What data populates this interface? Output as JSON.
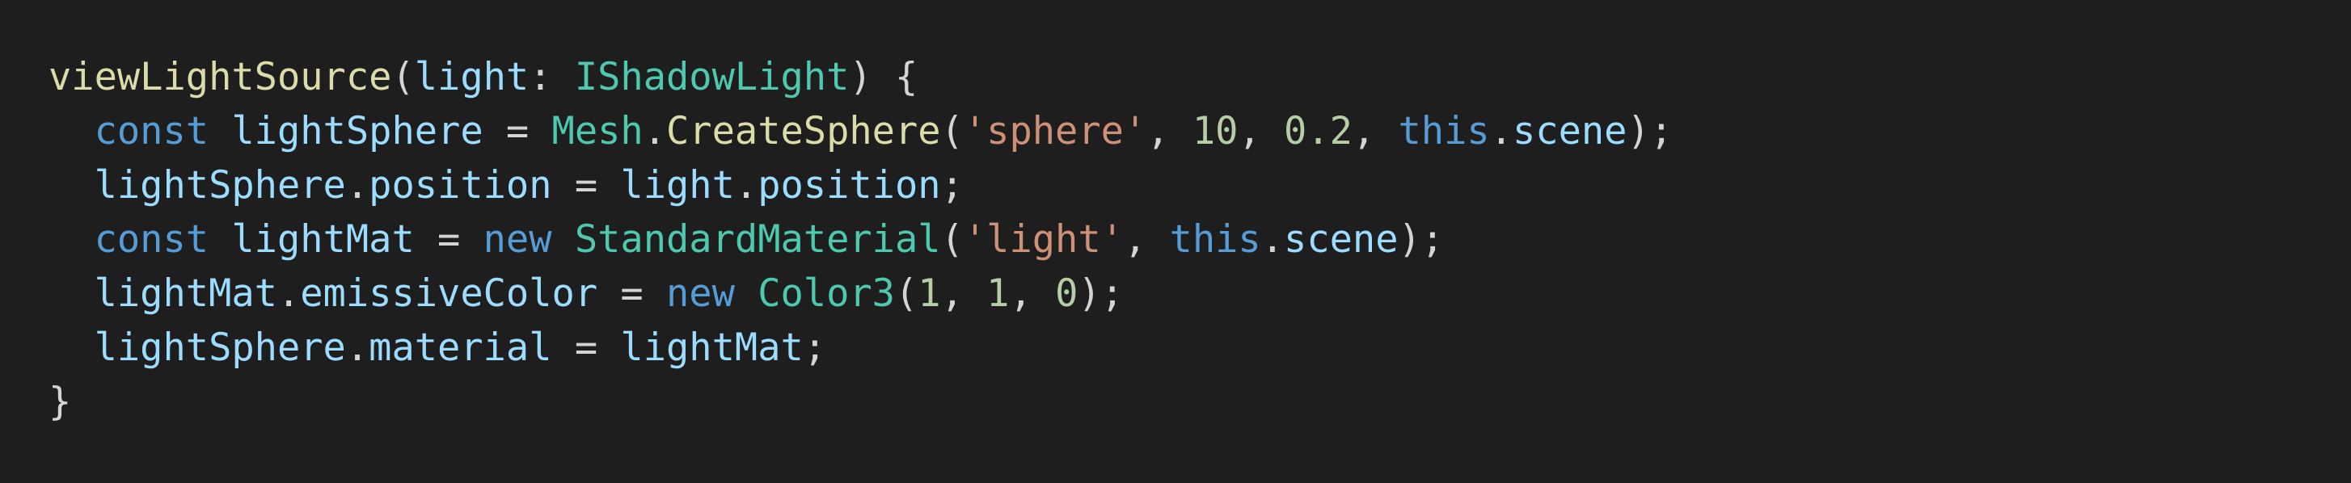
{
  "code_lines": [
    [
      {
        "t": "viewLightSource",
        "k": "func"
      },
      {
        "t": "(",
        "k": "punct"
      },
      {
        "t": "light",
        "k": "param"
      },
      {
        "t": ": ",
        "k": "punct"
      },
      {
        "t": "IShadowLight",
        "k": "type"
      },
      {
        "t": ") {",
        "k": "punct"
      }
    ],
    [
      {
        "t": "  ",
        "k": "punct"
      },
      {
        "t": "const",
        "k": "keyword"
      },
      {
        "t": " ",
        "k": "punct"
      },
      {
        "t": "lightSphere",
        "k": "var"
      },
      {
        "t": " = ",
        "k": "punct"
      },
      {
        "t": "Mesh",
        "k": "type"
      },
      {
        "t": ".",
        "k": "punct"
      },
      {
        "t": "CreateSphere",
        "k": "func"
      },
      {
        "t": "(",
        "k": "punct"
      },
      {
        "t": "'sphere'",
        "k": "string"
      },
      {
        "t": ", ",
        "k": "punct"
      },
      {
        "t": "10",
        "k": "number"
      },
      {
        "t": ", ",
        "k": "punct"
      },
      {
        "t": "0.2",
        "k": "number"
      },
      {
        "t": ", ",
        "k": "punct"
      },
      {
        "t": "this",
        "k": "keyword"
      },
      {
        "t": ".",
        "k": "punct"
      },
      {
        "t": "scene",
        "k": "prop"
      },
      {
        "t": ");",
        "k": "punct"
      }
    ],
    [
      {
        "t": "  ",
        "k": "punct"
      },
      {
        "t": "lightSphere",
        "k": "var"
      },
      {
        "t": ".",
        "k": "punct"
      },
      {
        "t": "position",
        "k": "prop"
      },
      {
        "t": " = ",
        "k": "punct"
      },
      {
        "t": "light",
        "k": "var"
      },
      {
        "t": ".",
        "k": "punct"
      },
      {
        "t": "position",
        "k": "prop"
      },
      {
        "t": ";",
        "k": "punct"
      }
    ],
    [
      {
        "t": "  ",
        "k": "punct"
      },
      {
        "t": "const",
        "k": "keyword"
      },
      {
        "t": " ",
        "k": "punct"
      },
      {
        "t": "lightMat",
        "k": "var"
      },
      {
        "t": " = ",
        "k": "punct"
      },
      {
        "t": "new",
        "k": "keyword"
      },
      {
        "t": " ",
        "k": "punct"
      },
      {
        "t": "StandardMaterial",
        "k": "type"
      },
      {
        "t": "(",
        "k": "punct"
      },
      {
        "t": "'light'",
        "k": "string"
      },
      {
        "t": ", ",
        "k": "punct"
      },
      {
        "t": "this",
        "k": "keyword"
      },
      {
        "t": ".",
        "k": "punct"
      },
      {
        "t": "scene",
        "k": "prop"
      },
      {
        "t": ");",
        "k": "punct"
      }
    ],
    [
      {
        "t": "  ",
        "k": "punct"
      },
      {
        "t": "lightMat",
        "k": "var"
      },
      {
        "t": ".",
        "k": "punct"
      },
      {
        "t": "emissiveColor",
        "k": "prop"
      },
      {
        "t": " = ",
        "k": "punct"
      },
      {
        "t": "new",
        "k": "keyword"
      },
      {
        "t": " ",
        "k": "punct"
      },
      {
        "t": "Color3",
        "k": "type"
      },
      {
        "t": "(",
        "k": "punct"
      },
      {
        "t": "1",
        "k": "number"
      },
      {
        "t": ", ",
        "k": "punct"
      },
      {
        "t": "1",
        "k": "number"
      },
      {
        "t": ", ",
        "k": "punct"
      },
      {
        "t": "0",
        "k": "number"
      },
      {
        "t": ");",
        "k": "punct"
      }
    ],
    [
      {
        "t": "  ",
        "k": "punct"
      },
      {
        "t": "lightSphere",
        "k": "var"
      },
      {
        "t": ".",
        "k": "punct"
      },
      {
        "t": "material",
        "k": "prop"
      },
      {
        "t": " = ",
        "k": "punct"
      },
      {
        "t": "lightMat",
        "k": "var"
      },
      {
        "t": ";",
        "k": "punct"
      }
    ],
    [
      {
        "t": "}",
        "k": "punct"
      }
    ]
  ],
  "colors": {
    "background": "#1e1e1e",
    "func": "#dcdcaa",
    "param": "#9cdcfe",
    "type": "#4ec9b0",
    "keyword": "#569cd6",
    "var": "#9cdcfe",
    "prop": "#9cdcfe",
    "string": "#ce9178",
    "number": "#b5cea8",
    "punct": "#d4d4d4"
  }
}
